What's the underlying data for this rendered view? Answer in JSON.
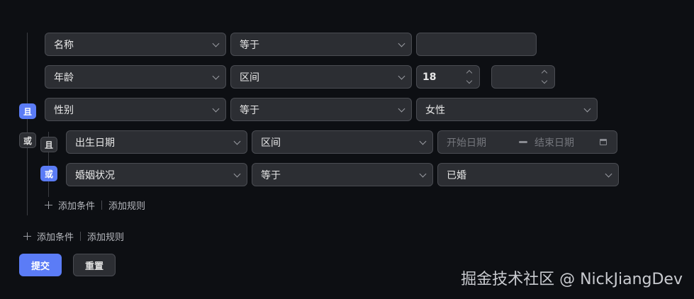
{
  "rules": [
    {
      "field": "名称",
      "operator": "等于",
      "value": ""
    },
    {
      "field": "年龄",
      "operator": "区间",
      "min": "18",
      "max": ""
    },
    {
      "field": "性别",
      "operator": "等于",
      "value": "女性"
    }
  ],
  "group": {
    "rules": [
      {
        "field": "出生日期",
        "operator": "区间",
        "start_placeholder": "开始日期",
        "end_placeholder": "结束日期"
      },
      {
        "field": "婚姻状况",
        "operator": "等于",
        "value": "已婚"
      }
    ],
    "badges": {
      "and": "且",
      "or": "或"
    },
    "add_condition": "添加条件",
    "add_rule": "添加规则"
  },
  "outer_badges": {
    "and": "且",
    "or": "或"
  },
  "add_condition": "添加条件",
  "add_rule": "添加规则",
  "buttons": {
    "submit": "提交",
    "reset": "重置"
  },
  "watermark": "掘金技术社区 @ NickJiangDev",
  "colors": {
    "accent": "#5b7cf6",
    "background": "#0d0f13",
    "input_bg": "#2c2e33",
    "border": "#4a4c52"
  }
}
